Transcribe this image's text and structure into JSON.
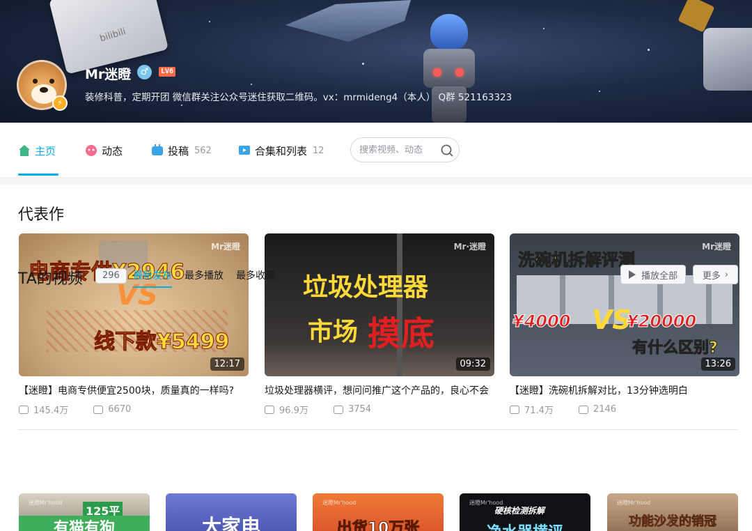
{
  "profile": {
    "username": "Mr迷瞪",
    "level_badge": "LV6",
    "gender_icon": "male-icon",
    "bio": "装修科普，定期开团 微信群关注公众号迷住获取二维码。vx：mrmideng4（本人） Q群 521163323",
    "banner_brand_text": "bilibili",
    "avatar_badge_icon": "lightning-icon"
  },
  "nav": {
    "items": [
      {
        "label": "主页",
        "count": "",
        "icon": "home-icon",
        "active": true
      },
      {
        "label": "动态",
        "count": "",
        "icon": "dynamic-icon",
        "active": false
      },
      {
        "label": "投稿",
        "count": "562",
        "icon": "upload-icon",
        "active": false
      },
      {
        "label": "合集和列表",
        "count": "12",
        "icon": "collection-icon",
        "active": false
      }
    ],
    "search_placeholder": "搜索视频、动态"
  },
  "representative": {
    "title": "代表作",
    "videos": [
      {
        "thumb_line1": "电商专供¥2946",
        "thumb_vs": "VS",
        "thumb_line2": "线下款¥5499",
        "watermark": "Mr迷瞪",
        "duration": "12:17",
        "title": "【迷瞪】电商专供便宜2500块，质量真的一样吗?",
        "plays": "145.4万",
        "comments": "6670"
      },
      {
        "thumb_line1": "垃圾处理器",
        "thumb_line2a": "市场",
        "thumb_line2b": "摸底",
        "watermark": "Mr·迷瞪",
        "duration": "09:32",
        "title": "垃圾处理器横评，想问问推广这个产品的，良心不会",
        "plays": "96.9万",
        "comments": "3754"
      },
      {
        "thumb_line1": "洗碗机拆解评测",
        "thumb_left": "¥4000",
        "thumb_vs": "VS",
        "thumb_right": "¥20000",
        "thumb_line2": "有什么区别?",
        "watermark": "Mr迷瞪",
        "duration": "13:26",
        "title": "【迷瞪】洗碗机拆解对比，13分钟选明白",
        "plays": "71.4万",
        "comments": "2146"
      }
    ]
  },
  "ta_videos": {
    "title": "TA的视频",
    "count": "296",
    "sort_tabs": [
      {
        "label": "最新发布",
        "active": true
      },
      {
        "label": "最多播放",
        "active": false
      },
      {
        "label": "最多收藏",
        "active": false
      }
    ],
    "play_all_label": "播放全部",
    "more_label": "更多",
    "thumbs": [
      {
        "label": "有猫有狗",
        "tag": "125平",
        "brand": "迷瞪Mr'hood"
      },
      {
        "label": "大家电",
        "tag": "",
        "brand": ""
      },
      {
        "label": "出货10万张",
        "tag": "",
        "brand": "迷瞪Mr'hood"
      },
      {
        "label": "净水器横评",
        "tag": "硬核检测拆解",
        "brand": "迷瞪Mr'hood"
      },
      {
        "label": "功能沙发的销冠",
        "tag": "",
        "brand": "迷瞪Mr'hood"
      }
    ]
  },
  "colors": {
    "accent": "#00aeec",
    "thumb_red": "#e02020",
    "thumb_yellow": "#ffd83a"
  }
}
